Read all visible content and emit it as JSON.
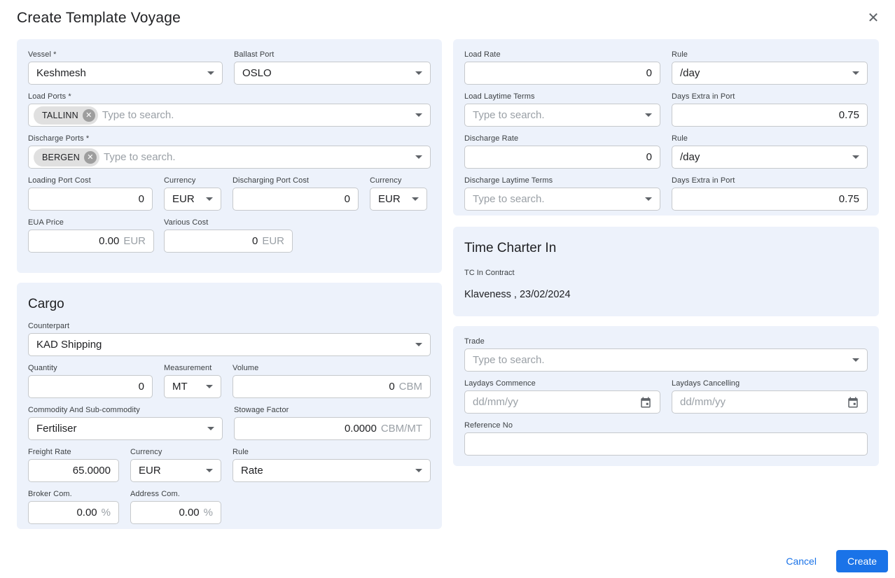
{
  "modal": {
    "title": "Create Template Voyage"
  },
  "colors": {
    "accent": "#1a73e8",
    "panel_bg": "#edf2fb",
    "border": "#c6c9cc",
    "muted_text": "#9aa0a6"
  },
  "icons": {
    "close": "close-icon",
    "chevron": "chevron-down-icon",
    "calendar": "calendar-icon",
    "chip_remove": "circle-close-icon"
  },
  "voyage": {
    "vessel": {
      "label": "Vessel *",
      "value": "Keshmesh"
    },
    "ballast_port": {
      "label": "Ballast Port",
      "value": "OSLO"
    },
    "load_ports": {
      "label": "Load Ports *",
      "chips": [
        "TALLINN"
      ],
      "placeholder": "Type to search."
    },
    "discharge_ports": {
      "label": "Discharge Ports *",
      "chips": [
        "BERGEN"
      ],
      "placeholder": "Type to search."
    },
    "loading_port_cost": {
      "label": "Loading Port Cost",
      "value": "0"
    },
    "loading_currency": {
      "label": "Currency",
      "value": "EUR"
    },
    "discharging_port_cost": {
      "label": "Discharging Port Cost",
      "value": "0"
    },
    "discharging_currency": {
      "label": "Currency",
      "value": "EUR"
    },
    "eua_price": {
      "label": "EUA Price",
      "value": "0.00",
      "unit": "EUR"
    },
    "various_cost": {
      "label": "Various Cost",
      "value": "0",
      "unit": "EUR"
    }
  },
  "cargo": {
    "section_title": "Cargo",
    "counterpart": {
      "label": "Counterpart",
      "value": "KAD Shipping"
    },
    "quantity": {
      "label": "Quantity",
      "value": "0"
    },
    "measurement": {
      "label": "Measurement",
      "value": "MT"
    },
    "volume": {
      "label": "Volume",
      "value": "0",
      "unit": "CBM"
    },
    "commodity": {
      "label": "Commodity And Sub-commodity",
      "value": "Fertiliser"
    },
    "stowage_factor": {
      "label": "Stowage Factor",
      "value": "0.0000",
      "unit": "CBM/MT"
    },
    "freight_rate": {
      "label": "Freight Rate",
      "value": "65.0000"
    },
    "freight_currency": {
      "label": "Currency",
      "value": "EUR"
    },
    "freight_rule": {
      "label": "Rule",
      "value": "Rate"
    },
    "broker_com": {
      "label": "Broker Com.",
      "value": "0.00",
      "unit": "%"
    },
    "address_com": {
      "label": "Address Com.",
      "value": "0.00",
      "unit": "%"
    }
  },
  "rates": {
    "load_rate": {
      "label": "Load Rate",
      "value": "0"
    },
    "load_rule": {
      "label": "Rule",
      "value": "/day"
    },
    "load_laytime_terms": {
      "label": "Load Laytime Terms",
      "placeholder": "Type to search."
    },
    "load_days_extra": {
      "label": "Days Extra in Port",
      "value": "0.75"
    },
    "discharge_rate": {
      "label": "Discharge Rate",
      "value": "0"
    },
    "discharge_rule": {
      "label": "Rule",
      "value": "/day"
    },
    "discharge_laytime_terms": {
      "label": "Discharge Laytime Terms",
      "placeholder": "Type to search."
    },
    "discharge_days_extra": {
      "label": "Days Extra in Port",
      "value": "0.75"
    }
  },
  "time_charter_in": {
    "section_title": "Time Charter In",
    "tc_in_contract_label": "TC In Contract",
    "tc_in_contract_value": "Klaveness , 23/02/2024"
  },
  "trade": {
    "trade": {
      "label": "Trade",
      "placeholder": "Type to search."
    },
    "laydays_commence": {
      "label": "Laydays Commence",
      "placeholder": "dd/mm/yy"
    },
    "laydays_cancelling": {
      "label": "Laydays Cancelling",
      "placeholder": "dd/mm/yy"
    },
    "reference_no": {
      "label": "Reference No",
      "value": ""
    }
  },
  "footer": {
    "cancel_label": "Cancel",
    "create_label": "Create"
  }
}
